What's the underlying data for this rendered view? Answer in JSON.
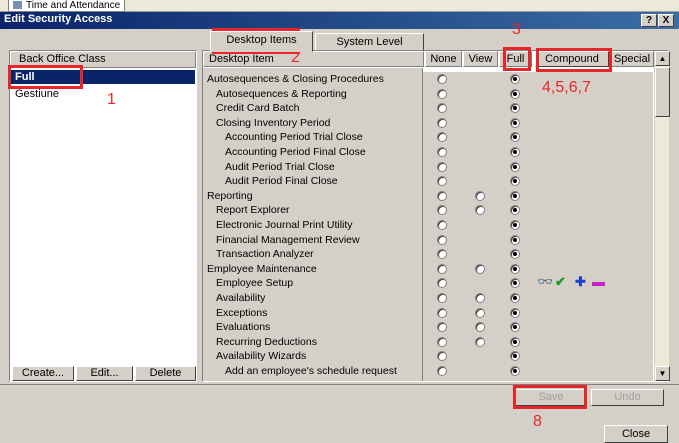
{
  "background_window": {
    "tab_label": "Time and Attendance"
  },
  "window": {
    "title": "Edit Security Access",
    "help_button": "?",
    "close_button": "X"
  },
  "left_panel": {
    "header": "Back Office Class",
    "items": [
      {
        "label": "Full",
        "selected": true
      },
      {
        "label": "Gestiune",
        "selected": false
      }
    ],
    "buttons": {
      "create": "Create...",
      "edit": "Edit...",
      "delete": "Delete"
    }
  },
  "tabs": [
    {
      "label": "Desktop Items",
      "active": true
    },
    {
      "label": "System Level",
      "active": false
    }
  ],
  "grid": {
    "column_headers": {
      "item": "Desktop Item",
      "none": "None",
      "view": "View",
      "full": "Full",
      "compound": "Compound",
      "special": "Special"
    },
    "rows": [
      {
        "label": "Autosequences & Closing Procedures",
        "level": 0,
        "none": true,
        "view": false,
        "full": true,
        "selected": "full"
      },
      {
        "label": "Autosequences & Reporting",
        "level": 1,
        "none": true,
        "view": false,
        "full": true,
        "selected": "full"
      },
      {
        "label": "Credit Card Batch",
        "level": 1,
        "none": true,
        "view": false,
        "full": true,
        "selected": "full"
      },
      {
        "label": "Closing Inventory Period",
        "level": 1,
        "none": true,
        "view": false,
        "full": true,
        "selected": "full"
      },
      {
        "label": "Accounting Period Trial Close",
        "level": 2,
        "none": true,
        "view": false,
        "full": true,
        "selected": "full"
      },
      {
        "label": "Accounting Period Final Close",
        "level": 2,
        "none": true,
        "view": false,
        "full": true,
        "selected": "full"
      },
      {
        "label": "Audit Period Trial Close",
        "level": 2,
        "none": true,
        "view": false,
        "full": true,
        "selected": "full"
      },
      {
        "label": "Audit Period Final Close",
        "level": 2,
        "none": true,
        "view": false,
        "full": true,
        "selected": "full"
      },
      {
        "label": "Reporting",
        "level": 0,
        "none": true,
        "view": true,
        "full": true,
        "selected": "full"
      },
      {
        "label": "Report Explorer",
        "level": 1,
        "none": true,
        "view": true,
        "full": true,
        "selected": "full"
      },
      {
        "label": "Electronic Journal Print Utility",
        "level": 1,
        "none": true,
        "view": false,
        "full": true,
        "selected": "full"
      },
      {
        "label": "Financial Management Review",
        "level": 1,
        "none": true,
        "view": false,
        "full": true,
        "selected": "full"
      },
      {
        "label": "Transaction Analyzer",
        "level": 1,
        "none": true,
        "view": false,
        "full": true,
        "selected": "full"
      },
      {
        "label": "Employee Maintenance",
        "level": 0,
        "none": true,
        "view": true,
        "full": true,
        "selected": "full"
      },
      {
        "label": "Employee Setup",
        "level": 1,
        "none": true,
        "view": false,
        "full": true,
        "selected": "full",
        "compound_icons": [
          "view-icon",
          "check-icon",
          "add-icon",
          "delete-icon"
        ]
      },
      {
        "label": "Availability",
        "level": 1,
        "none": true,
        "view": true,
        "full": true,
        "selected": "full"
      },
      {
        "label": "Exceptions",
        "level": 1,
        "none": true,
        "view": true,
        "full": true,
        "selected": "full"
      },
      {
        "label": "Evaluations",
        "level": 1,
        "none": true,
        "view": true,
        "full": true,
        "selected": "full"
      },
      {
        "label": "Recurring Deductions",
        "level": 1,
        "none": true,
        "view": true,
        "full": true,
        "selected": "full"
      },
      {
        "label": "Availability Wizards",
        "level": 1,
        "none": true,
        "view": false,
        "full": true,
        "selected": "full"
      },
      {
        "label": "Add an employee's schedule request",
        "level": 2,
        "none": true,
        "view": false,
        "full": true,
        "selected": "full"
      }
    ]
  },
  "footer": {
    "save": "Save",
    "undo": "Undo",
    "close": "Close"
  },
  "annotations": {
    "n1": "1",
    "n2": "2",
    "n3": "3",
    "n4567": "4,5,6,7",
    "n8": "8",
    "color": "#e8262a"
  },
  "colors": {
    "title_bar": "#0a246a",
    "selection": "#0a246a",
    "face": "#d4d0c8"
  }
}
